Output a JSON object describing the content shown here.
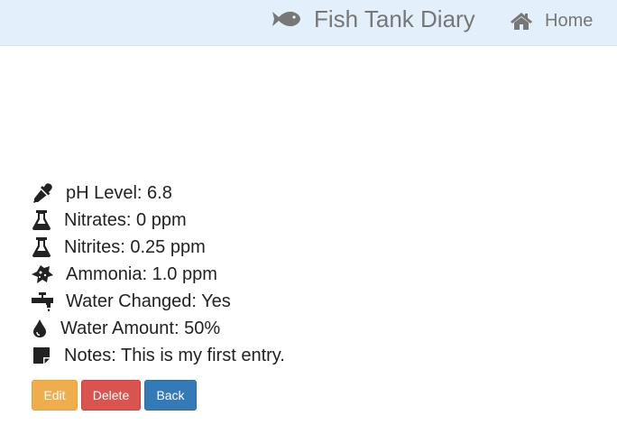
{
  "navbar": {
    "brand": "Fish Tank Diary",
    "brand_icon": "fish-icon",
    "home_label": "Home",
    "home_icon": "home-icon",
    "background": "#e3f0fb"
  },
  "entry": {
    "ph": "pH Level: 6.8",
    "nitrates": "Nitrates: 0 ppm",
    "nitrites": "Nitrites: 0.25 ppm",
    "ammonia": "Ammonia: 1.0 ppm",
    "water_changed": "Water Changed: Yes",
    "water_amount": "Water Amount: 50%",
    "notes": "Notes: This is my first entry."
  },
  "icons": {
    "ph": "eyedropper-icon",
    "nitrates": "flask-icon",
    "nitrites": "flask-icon",
    "ammonia": "bacteria-icon",
    "water_changed": "faucet-icon",
    "water_amount": "droplet-icon",
    "notes": "sticky-note-icon"
  },
  "actions": {
    "edit": "Edit",
    "delete": "Delete",
    "back": "Back"
  },
  "colors": {
    "edit": "#f0ad4e",
    "delete": "#d9534f",
    "back": "#337ab7",
    "icon": "#222222"
  }
}
